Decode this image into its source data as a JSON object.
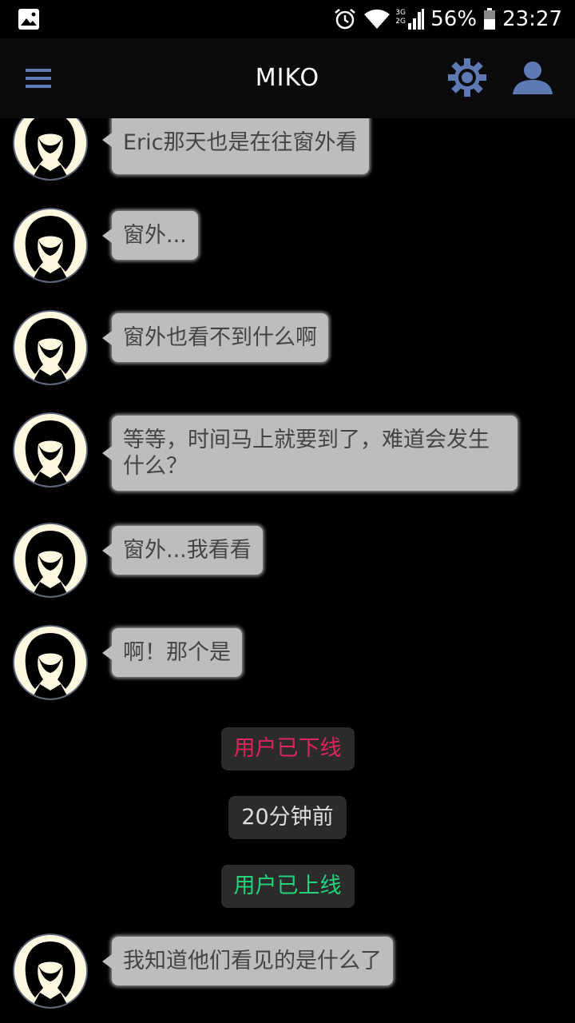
{
  "status_bar": {
    "network_label": "3G 2G",
    "battery": "56%",
    "time": "23:27"
  },
  "header": {
    "title": "MIKO",
    "icons": [
      "menu-icon",
      "gear-icon",
      "person-icon"
    ]
  },
  "messages": [
    {
      "text": "Eric那天也是在往窗外看"
    },
    {
      "text": "窗外..."
    },
    {
      "text": "窗外也看不到什么啊"
    },
    {
      "text": "等等，时间马上就要到了，难道会发生什么？"
    },
    {
      "text": "窗外...我看看"
    },
    {
      "text": "啊！那个是"
    },
    {
      "text": "我知道他们看见的是什么了"
    }
  ],
  "system_notices": {
    "offline": "用户已下线",
    "timestamp": "20分钟前",
    "online": "用户已上线"
  },
  "colors": {
    "offline": "#e0245e",
    "timestamp": "#dddddd",
    "online": "#1fd47a",
    "icon_accent": "#5d7ab5"
  }
}
